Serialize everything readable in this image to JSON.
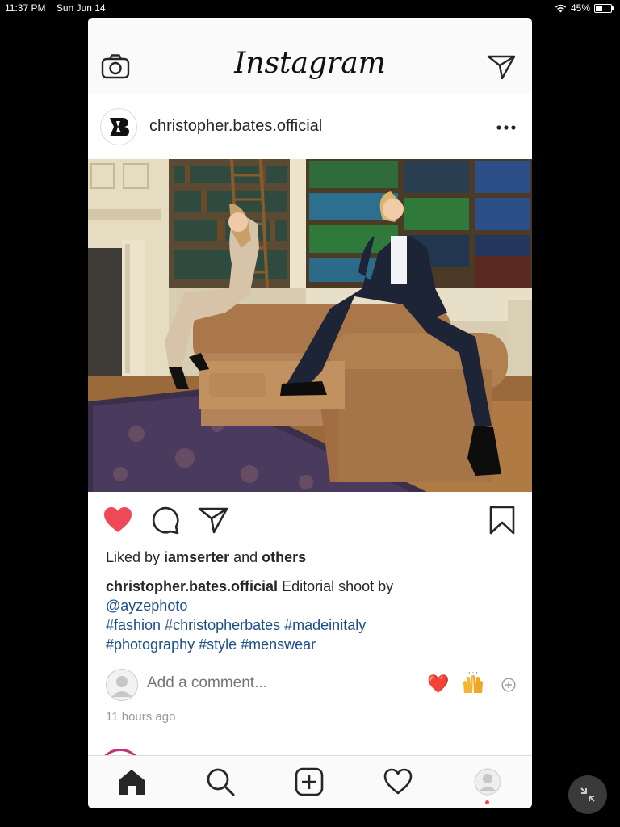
{
  "status_bar": {
    "time": "11:37 PM",
    "date": "Sun Jun 14",
    "battery": "45%",
    "battery_level": 0.45
  },
  "app": {
    "title": "Instagram"
  },
  "post": {
    "username": "christopher.bates.official",
    "liked_by_prefix": "Liked by ",
    "liked_by_user": "iamserter",
    "liked_by_and": " and ",
    "liked_by_others": "others",
    "caption_user": "christopher.bates.official",
    "caption_text": " Editorial shoot by ",
    "mention": "@ayzephoto",
    "hashtags_line1": "#fashion #christopherbates #madeinitaly",
    "hashtags_line2": "#photography #style #menswear",
    "liked": true,
    "time_ago": "11 hours ago"
  },
  "comment": {
    "placeholder": "Add a comment...",
    "quick_reactions": [
      "❤️",
      "🙌"
    ]
  },
  "icons": {
    "top": [
      "camera-icon",
      "direct-send-icon"
    ],
    "actions": [
      "heart-filled-icon",
      "comment-icon",
      "share-icon",
      "bookmark-icon"
    ],
    "tabs": [
      "home-icon",
      "search-icon",
      "add-post-icon",
      "activity-heart-icon",
      "profile-icon"
    ]
  },
  "colors": {
    "like_red": "#ed4956",
    "link_blue": "#1d4f8a",
    "story_ring": "#c92f7d",
    "notification_dot": "#ed4956"
  }
}
